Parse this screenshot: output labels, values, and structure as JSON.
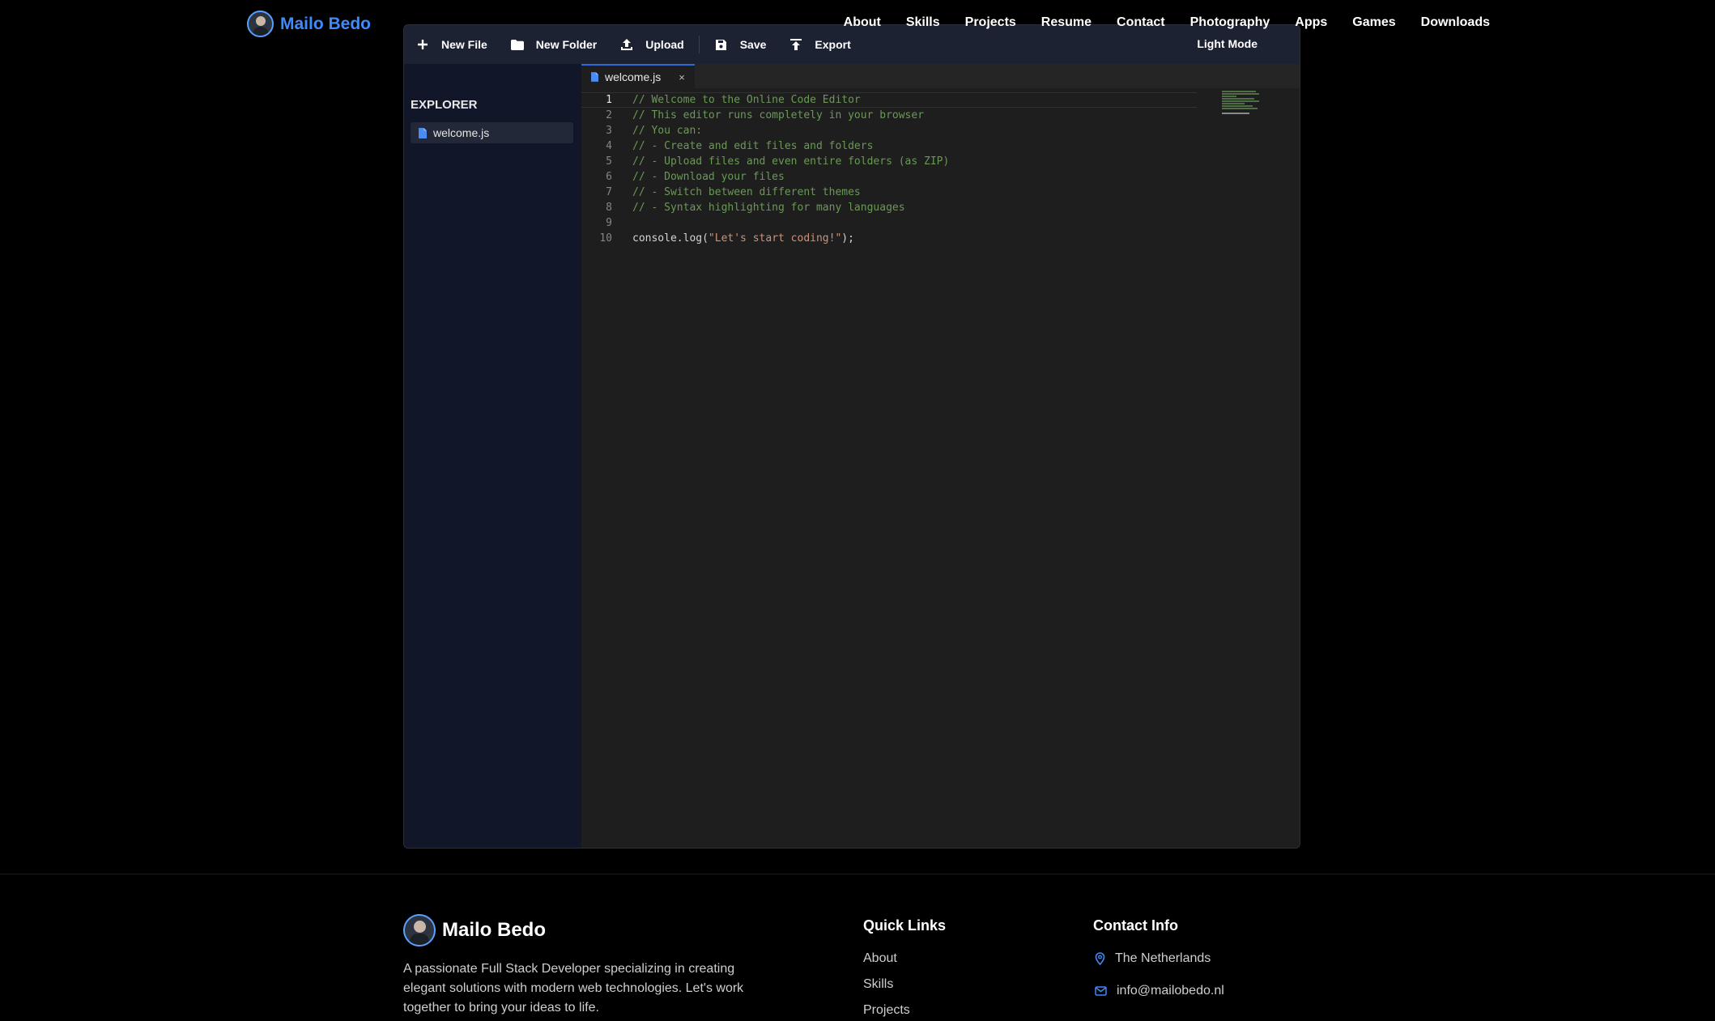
{
  "nav": {
    "brand": "Mailo Bedo",
    "links": [
      "About",
      "Skills",
      "Projects",
      "Resume",
      "Contact",
      "Photography",
      "Apps",
      "Games",
      "Downloads"
    ]
  },
  "toolbar": {
    "new_file": "New File",
    "new_folder": "New Folder",
    "upload": "Upload",
    "save": "Save",
    "export": "Export",
    "theme_toggle": "Light Mode"
  },
  "explorer": {
    "title": "EXPLORER",
    "files": [
      "welcome.js"
    ]
  },
  "editor": {
    "active_tab": "welcome.js",
    "close_glyph": "×",
    "lines": [
      {
        "num": "1",
        "text": "// Welcome to the Online Code Editor"
      },
      {
        "num": "2",
        "text": "// This editor runs completely in your browser"
      },
      {
        "num": "3",
        "text": "// You can:"
      },
      {
        "num": "4",
        "text": "// - Create and edit files and folders"
      },
      {
        "num": "5",
        "text": "// - Upload files and even entire folders (as ZIP)"
      },
      {
        "num": "6",
        "text": "// - Download your files"
      },
      {
        "num": "7",
        "text": "// - Switch between different themes"
      },
      {
        "num": "8",
        "text": "// - Syntax highlighting for many languages"
      },
      {
        "num": "9",
        "text": ""
      },
      {
        "num": "10",
        "code": "console.log(",
        "string": "\"Let's start coding!\"",
        "tail": ");"
      }
    ]
  },
  "footer": {
    "brand": "Mailo Bedo",
    "description": "A passionate Full Stack Developer specializing in creating elegant solutions with modern web technologies. Let's work together to bring your ideas to life.",
    "quick_links_title": "Quick Links",
    "quick_links": [
      "About",
      "Skills",
      "Projects"
    ],
    "contact_title": "Contact Info",
    "location": "The Netherlands",
    "email": "info@mailobedo.nl"
  },
  "colors": {
    "accent": "#3d8bfd",
    "comment": "#6a9955",
    "string": "#ce9178"
  }
}
